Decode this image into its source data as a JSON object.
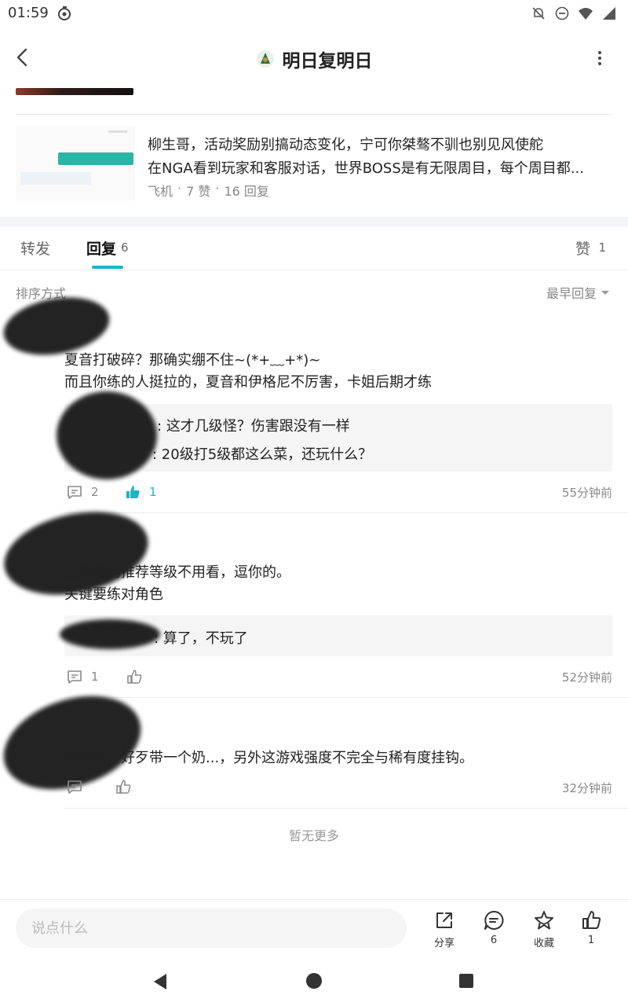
{
  "status_bar": {
    "time": "01:59"
  },
  "header": {
    "title": "明日复明日"
  },
  "post": {
    "line1": "柳生哥，活动奖励别搞动态变化，宁可你桀骜不驯也别见风使舵",
    "line2": "在NGA看到玩家和客服对话，世界BOSS是有无限周目，每个周目都...",
    "meta": [
      "飞机",
      "·",
      "7 赞",
      "·",
      "16 回复"
    ]
  },
  "tabs": {
    "repost": "转发",
    "reply": "回复",
    "reply_count": "6",
    "like": "赞",
    "like_count": "1"
  },
  "sort": {
    "label": "排序方式",
    "current": "最早回复"
  },
  "comments": [
    {
      "lines": [
        "夏音打破碎？那确实绷不住~(*+﹏+*)~",
        "而且你练的人挺拉的，夏音和伊格尼不厉害，卡姐后期才练"
      ],
      "quotes": [
        ": 这才几级怪？伤害跟没有一样",
        ": 20级打5级都这么菜，还玩什么？"
      ],
      "reply_count": "2",
      "like_count": "1",
      "time": "55分钟前"
    },
    {
      "lines": [
        "这游戏的推荐等级不用看，逗你的。",
        "关键要练对角色"
      ],
      "quotes": [
        ": 算了，不玩了"
      ],
      "reply_count": "1",
      "like_count": "",
      "time": "52分钟前"
    },
    {
      "lines": [
        "没带奶，好歹带一个奶...，另外这游戏强度不完全与稀有度挂钩。"
      ],
      "quotes": [],
      "reply_count": "",
      "like_count": "",
      "time": "32分钟前"
    }
  ],
  "footer": {
    "no_more": "暂无更多"
  },
  "bottom_bar": {
    "input_placeholder": "说点什么",
    "share": "分享",
    "comments": "6",
    "favorite": "收藏",
    "likes": "1"
  },
  "colors": {
    "accent": "#1bb5c6"
  }
}
